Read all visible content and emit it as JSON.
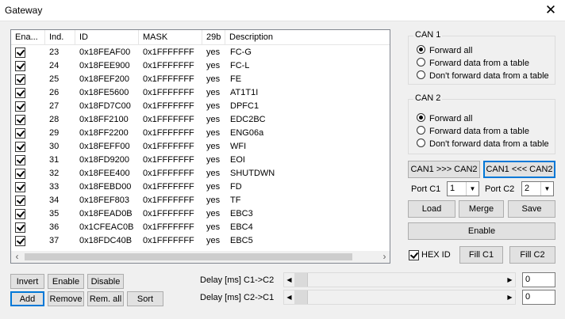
{
  "window": {
    "title": "Gateway"
  },
  "list": {
    "columns": [
      "Ena...",
      "Ind.",
      "ID",
      "MASK",
      "29b",
      "Description"
    ],
    "rows": [
      {
        "ind": "23",
        "id": "0x18FEAF00",
        "mask": "0x1FFFFFFF",
        "b29": "yes",
        "desc": "FC-G"
      },
      {
        "ind": "24",
        "id": "0x18FEE900",
        "mask": "0x1FFFFFFF",
        "b29": "yes",
        "desc": "FC-L"
      },
      {
        "ind": "25",
        "id": "0x18FEF200",
        "mask": "0x1FFFFFFF",
        "b29": "yes",
        "desc": "FE"
      },
      {
        "ind": "26",
        "id": "0x18FE5600",
        "mask": "0x1FFFFFFF",
        "b29": "yes",
        "desc": "AT1T1I"
      },
      {
        "ind": "27",
        "id": "0x18FD7C00",
        "mask": "0x1FFFFFFF",
        "b29": "yes",
        "desc": "DPFC1"
      },
      {
        "ind": "28",
        "id": "0x18FF2100",
        "mask": "0x1FFFFFFF",
        "b29": "yes",
        "desc": "EDC2BC"
      },
      {
        "ind": "29",
        "id": "0x18FF2200",
        "mask": "0x1FFFFFFF",
        "b29": "yes",
        "desc": "ENG06a"
      },
      {
        "ind": "30",
        "id": "0x18FEFF00",
        "mask": "0x1FFFFFFF",
        "b29": "yes",
        "desc": "WFI"
      },
      {
        "ind": "31",
        "id": "0x18FD9200",
        "mask": "0x1FFFFFFF",
        "b29": "yes",
        "desc": "EOI"
      },
      {
        "ind": "32",
        "id": "0x18FEE400",
        "mask": "0x1FFFFFFF",
        "b29": "yes",
        "desc": "SHUTDWN"
      },
      {
        "ind": "33",
        "id": "0x18FEBD00",
        "mask": "0x1FFFFFFF",
        "b29": "yes",
        "desc": "FD"
      },
      {
        "ind": "34",
        "id": "0x18FEF803",
        "mask": "0x1FFFFFFF",
        "b29": "yes",
        "desc": "TF"
      },
      {
        "ind": "35",
        "id": "0x18FEAD0B",
        "mask": "0x1FFFFFFF",
        "b29": "yes",
        "desc": "EBC3"
      },
      {
        "ind": "36",
        "id": "0x1CFEAC0B",
        "mask": "0x1FFFFFFF",
        "b29": "yes",
        "desc": "EBC4"
      },
      {
        "ind": "37",
        "id": "0x18FDC40B",
        "mask": "0x1FFFFFFF",
        "b29": "yes",
        "desc": "EBC5"
      }
    ]
  },
  "can1": {
    "label": "CAN 1",
    "options": [
      "Forward all",
      "Forward data from a table",
      "Don't forward data from a table"
    ]
  },
  "can2": {
    "label": "CAN 2",
    "options": [
      "Forward all",
      "Forward data from a table",
      "Don't forward data from a table"
    ]
  },
  "direction": {
    "c1_to_c2": "CAN1 >>> CAN2",
    "c2_to_c1": "CAN1 <<< CAN2"
  },
  "ports": {
    "c1_label": "Port C1",
    "c1_value": "1",
    "c2_label": "Port C2",
    "c2_value": "2"
  },
  "table_buttons": {
    "load": "Load",
    "merge": "Merge",
    "save": "Save",
    "enable": "Enable"
  },
  "hex": {
    "label": "HEX ID",
    "fill_c1": "Fill C1",
    "fill_c2": "Fill C2"
  },
  "bottom_buttons": {
    "invert": "Invert",
    "enable": "Enable",
    "disable": "Disable",
    "add": "Add",
    "remove": "Remove",
    "rem_all": "Rem. all",
    "sort": "Sort"
  },
  "delays": {
    "c1c2_label": "Delay [ms] C1->C2",
    "c1c2_value": "0",
    "c2c1_label": "Delay [ms] C2->C1",
    "c2c1_value": "0"
  }
}
